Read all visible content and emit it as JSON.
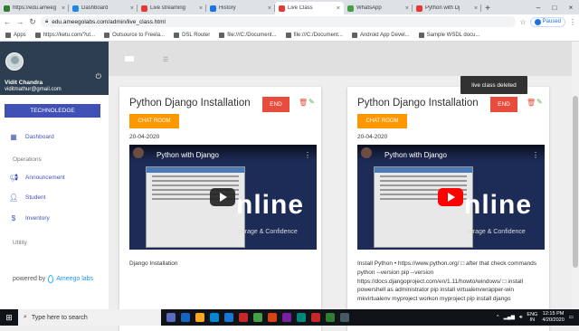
{
  "browser": {
    "tabs": [
      {
        "label": "https://edu.ameeg",
        "color": "#2e7d32",
        "active": false
      },
      {
        "label": "Dashboard",
        "color": "#1e88e5",
        "active": false
      },
      {
        "label": "Live streaming",
        "color": "#e53935",
        "active": false
      },
      {
        "label": "History",
        "color": "#1a73e8",
        "active": false
      },
      {
        "label": "Live Class",
        "color": "#e53935",
        "active": true
      },
      {
        "label": "WhatsApp",
        "color": "#43a047",
        "active": false
      },
      {
        "label": "Python with Dj",
        "color": "#e53935",
        "active": false
      }
    ],
    "url": "edu.ameegolabs.com/admin/live_class.html",
    "profile_status": "Paused",
    "bookmarks": [
      "Apps",
      "https://ketu.com/?ut...",
      "Outsource to Freela...",
      "DSL Router",
      "file:///C:/Document...",
      "file:///C:/Document...",
      "Android App Devel...",
      "Sample WSDL docu..."
    ]
  },
  "sidebar": {
    "user_name": "Vidit Chandra",
    "user_email": "viditmathur@gmail.com",
    "org_button": "TECHNOLEDGE",
    "dashboard": "Dashboard",
    "operations_header": "Operations",
    "announcement": "Announcement",
    "student": "Student",
    "inventory": "Inventory",
    "utility_header": "Utility",
    "powered_by": "powered by",
    "brand": "Ameego labs"
  },
  "cards": [
    {
      "title": "Python Django Installation",
      "end_label": "END",
      "chat_label": "CHAT ROOM",
      "date": "20-04-2020",
      "video_title": "Python with Django",
      "video_big": "nline",
      "video_sub": "ourage & Confidence",
      "description": "Django Installation"
    },
    {
      "title": "Python Django Installation",
      "end_label": "END",
      "chat_label": "CHAT ROOM",
      "date": "20-04-2020",
      "video_title": "Python with Django",
      "video_big": "nline",
      "video_sub": "ourage & Confidence",
      "description": "Install Python • https://www.python.org/ □ after that check commands python --version pip --version https://docs.djangoproject.com/en/1.11/howto/windows/ □ install powershell as administrator pip install virtualenvwrapper-win mkvirtualenv myproject workon myproject pip install django"
    }
  ],
  "toast": "live class deleted",
  "taskbar": {
    "search_placeholder": "Type here to search",
    "lang": "ENG",
    "region": "IN",
    "time": "12:15 PM",
    "date": "4/20/2020"
  }
}
